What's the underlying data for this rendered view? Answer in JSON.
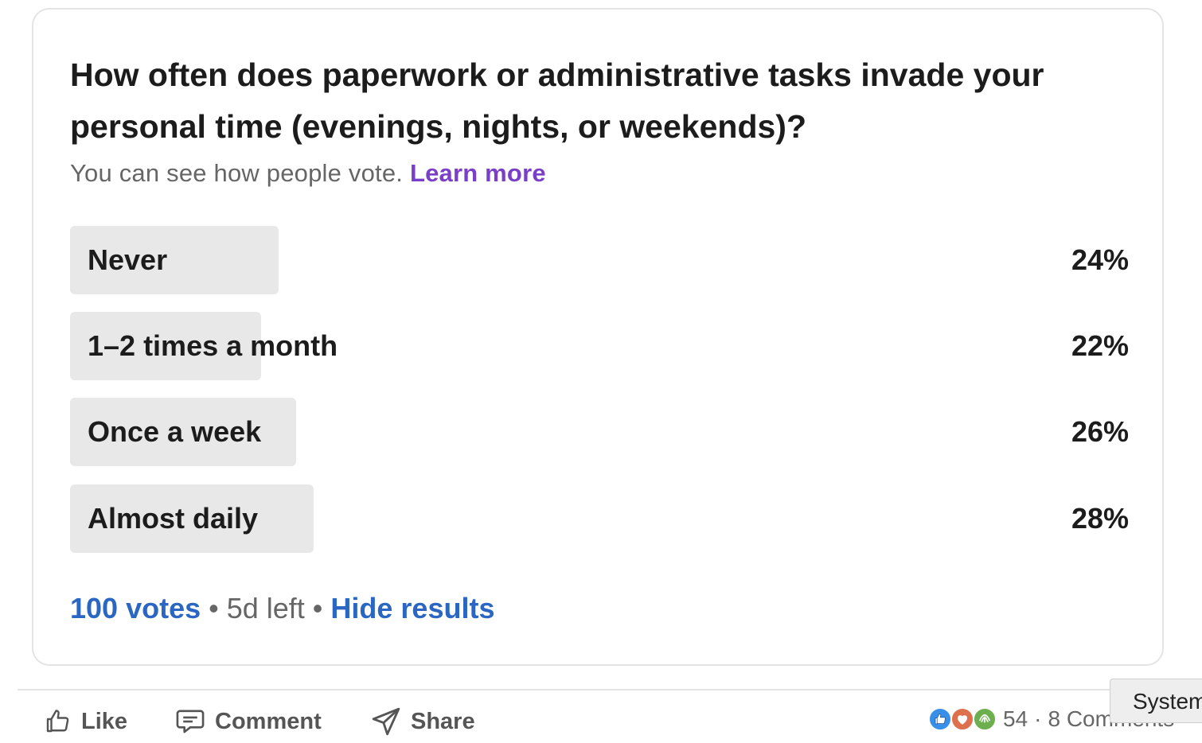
{
  "poll": {
    "question": "How often does paperwork or administrative tasks invade your personal time (evenings, nights, or weekends)?",
    "visibility_text": "You can see how people vote.",
    "learn_more": "Learn more",
    "options": [
      {
        "label": "Never",
        "percent_text": "24%",
        "percent": 24
      },
      {
        "label": "1–2 times a month",
        "percent_text": "22%",
        "percent": 22
      },
      {
        "label": "Once a week",
        "percent_text": "26%",
        "percent": 26
      },
      {
        "label": "Almost daily",
        "percent_text": "28%",
        "percent": 28
      }
    ],
    "votes": "100 votes",
    "time_left": "5d left",
    "hide_results": "Hide results"
  },
  "actions": {
    "like": "Like",
    "comment": "Comment",
    "share": "Share"
  },
  "social": {
    "reactions": [
      "like-icon",
      "love-icon",
      "support-icon"
    ],
    "reaction_count": "54",
    "separator": "·",
    "comments": "8 Comments"
  },
  "tooltip": {
    "text": "System"
  },
  "colors": {
    "link_blue": "#2a66c2",
    "learn_purple": "#7a3fc9",
    "bar_fill": "#e8e8e8",
    "like_blue": "#378fe9",
    "love_red": "#df704d",
    "support_green": "#6dae4f"
  }
}
